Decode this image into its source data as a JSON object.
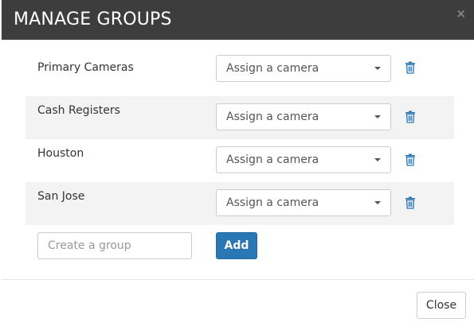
{
  "dialog": {
    "title": "MANAGE GROUPS",
    "close_icon": "×"
  },
  "groups": [
    {
      "name": "Primary Cameras",
      "camera_select": "Assign a camera"
    },
    {
      "name": "Cash Registers",
      "camera_select": "Assign a camera"
    },
    {
      "name": "Houston",
      "camera_select": "Assign a camera"
    },
    {
      "name": "San Jose",
      "camera_select": "Assign a camera"
    }
  ],
  "create": {
    "placeholder": "Create a group",
    "value": "",
    "add_label": "Add"
  },
  "footer": {
    "close_label": "Close"
  },
  "icons": {
    "dropdown": "chevron-down-icon",
    "delete": "trash-icon"
  },
  "colors": {
    "header_bg": "#3d3d3d",
    "accent": "#2a77b6",
    "row_shade": "#f3f3f3"
  }
}
